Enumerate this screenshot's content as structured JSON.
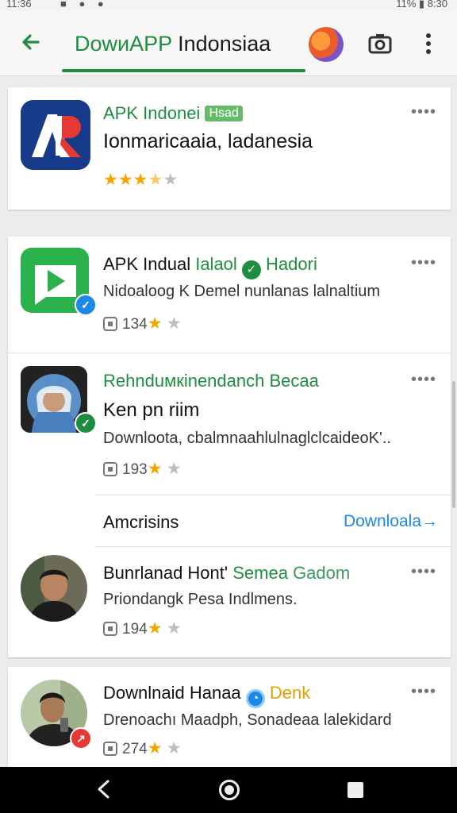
{
  "status_bar": {
    "time": "11:36",
    "right": "11% ▮ 8:30"
  },
  "app_bar": {
    "title_green": "DowиAPP",
    "title_rest": " Indonsiaa",
    "back_icon": "arrow-left-icon",
    "camera_icon": "camera-icon",
    "menu_icon": "more-vert-icon"
  },
  "colors": {
    "accent": "#1e8e3e",
    "link": "#1e88e5",
    "star": "#f2a600"
  },
  "cards": [
    {
      "title": "APK Indonei",
      "tag": "Hsad",
      "subtitle": "Ionmaricaaia, ladanesia",
      "rating": 3.5
    }
  ],
  "list": [
    {
      "title": "APK Indual",
      "title_green": "Ialaol",
      "title_green2": "Hadori",
      "desc": "Nidoaloog K Demel nunlanas lalnaltium",
      "count": "134",
      "stars_on": 1
    },
    {
      "title_green": "Rehnduмкinendanch Becaa",
      "subtitle": "Ken pn riim",
      "desc": "Downloota, cbalmnaahlulnaglclcaideoK'..",
      "count": "193",
      "stars_on": 1
    },
    {
      "title": "Bunrlanad Hont'",
      "title_green": "Semea",
      "title_light": "Gadom",
      "desc": "Priondangk Pesa Indlmens.",
      "count": "194",
      "stars_on": 1
    },
    {
      "title": "Downlnaid Hanaa",
      "title_orange": "Denk",
      "desc": "Drenoachı Maadph, Sonadeaa lalekidard",
      "count": "274",
      "stars_on": 1
    }
  ],
  "section": {
    "title": "Amcrisins",
    "link": "Downloala→"
  },
  "nav": {
    "back_icon": "nav-back-icon",
    "home_icon": "nav-home-icon",
    "recent_icon": "nav-recent-icon"
  }
}
